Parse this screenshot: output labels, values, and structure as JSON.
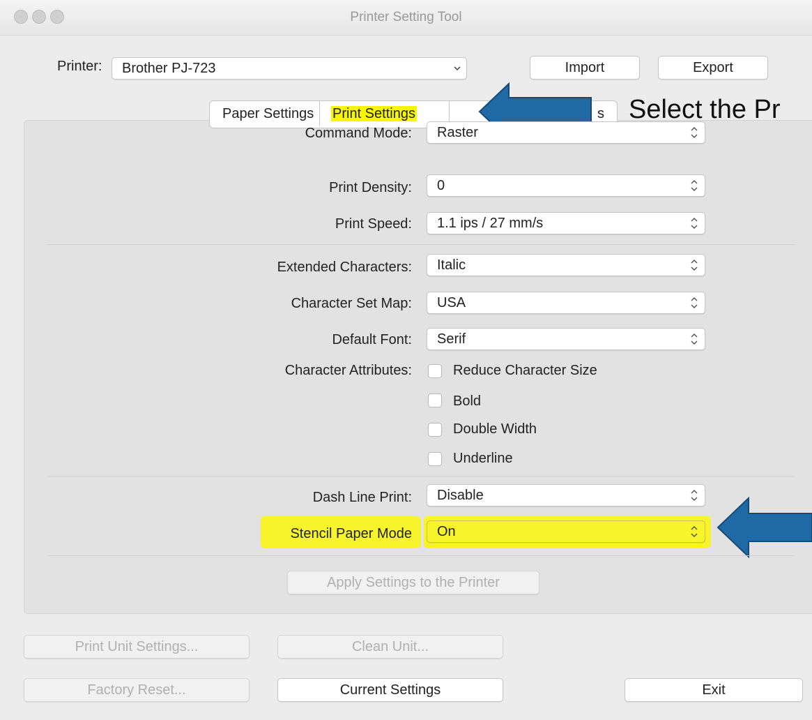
{
  "window": {
    "title": "Printer Setting Tool"
  },
  "printer": {
    "label": "Printer:",
    "value": "Brother PJ-723"
  },
  "buttons": {
    "import": "Import",
    "export": "Export",
    "apply": "Apply Settings to the Printer",
    "print_unit": "Print Unit Settings...",
    "clean_unit": "Clean Unit...",
    "factory_reset": "Factory Reset...",
    "current_settings": "Current Settings",
    "exit": "Exit"
  },
  "tabs": [
    {
      "label": "Paper Settings",
      "selected": false
    },
    {
      "label": "Print Settings",
      "selected": true
    },
    {
      "label": "s",
      "selected": false
    }
  ],
  "annotation": {
    "text": "Select the Pr"
  },
  "settings": {
    "command_mode": {
      "label": "Command Mode:",
      "value": "Raster"
    },
    "print_density": {
      "label": "Print Density:",
      "value": "0"
    },
    "print_speed": {
      "label": "Print Speed:",
      "value": "1.1 ips / 27 mm/s"
    },
    "extended_characters": {
      "label": "Extended Characters:",
      "value": "Italic"
    },
    "character_set_map": {
      "label": "Character Set Map:",
      "value": "USA"
    },
    "default_font": {
      "label": "Default Font:",
      "value": "Serif"
    },
    "character_attributes": {
      "label": "Character Attributes:",
      "options": [
        "Reduce Character Size",
        "Bold",
        "Double Width",
        "Underline"
      ]
    },
    "dash_line_print": {
      "label": "Dash Line Print:",
      "value": "Disable"
    },
    "stencil_paper_mode": {
      "label": "Stencil Paper Mode",
      "value": "On"
    }
  },
  "colors": {
    "highlight": "#f8f600",
    "arrow": "#1f6aa5"
  }
}
